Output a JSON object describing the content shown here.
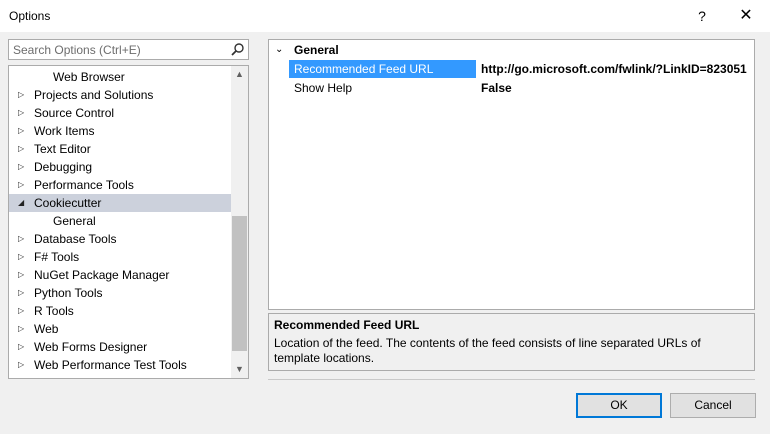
{
  "window": {
    "title": "Options",
    "help_label": "?",
    "close_label": "✕"
  },
  "search": {
    "placeholder": "Search Options (Ctrl+E)",
    "icon": "search-icon"
  },
  "tree": {
    "items": [
      {
        "label": "Web Browser",
        "arrow": "",
        "child": true,
        "selected": false
      },
      {
        "label": "Projects and Solutions",
        "arrow": "▷",
        "child": false,
        "selected": false
      },
      {
        "label": "Source Control",
        "arrow": "▷",
        "child": false,
        "selected": false
      },
      {
        "label": "Work Items",
        "arrow": "▷",
        "child": false,
        "selected": false
      },
      {
        "label": "Text Editor",
        "arrow": "▷",
        "child": false,
        "selected": false
      },
      {
        "label": "Debugging",
        "arrow": "▷",
        "child": false,
        "selected": false
      },
      {
        "label": "Performance Tools",
        "arrow": "▷",
        "child": false,
        "selected": false
      },
      {
        "label": "Cookiecutter",
        "arrow": "◢",
        "child": false,
        "selected": true
      },
      {
        "label": "General",
        "arrow": "",
        "child": true,
        "selected": false
      },
      {
        "label": "Database Tools",
        "arrow": "▷",
        "child": false,
        "selected": false
      },
      {
        "label": "F# Tools",
        "arrow": "▷",
        "child": false,
        "selected": false
      },
      {
        "label": "NuGet Package Manager",
        "arrow": "▷",
        "child": false,
        "selected": false
      },
      {
        "label": "Python Tools",
        "arrow": "▷",
        "child": false,
        "selected": false
      },
      {
        "label": "R Tools",
        "arrow": "▷",
        "child": false,
        "selected": false
      },
      {
        "label": "Web",
        "arrow": "▷",
        "child": false,
        "selected": false
      },
      {
        "label": "Web Forms Designer",
        "arrow": "▷",
        "child": false,
        "selected": false
      },
      {
        "label": "Web Performance Test Tools",
        "arrow": "▷",
        "child": false,
        "selected": false
      }
    ],
    "scroll_up": "▲",
    "scroll_down": "▼"
  },
  "grid": {
    "category": {
      "chevron": "⌄",
      "name": "General"
    },
    "properties": [
      {
        "name": "Recommended Feed URL",
        "value": "http://go.microsoft.com/fwlink/?LinkID=823051",
        "selected": true
      },
      {
        "name": "Show Help",
        "value": "False",
        "selected": false
      }
    ]
  },
  "description": {
    "title": "Recommended Feed URL",
    "text": "Location of the feed. The contents of the feed consists of line separated URLs of template locations."
  },
  "buttons": {
    "ok": "OK",
    "cancel": "Cancel"
  },
  "colors": {
    "accent": "#0078d7",
    "selection": "#3399ff",
    "tree_selection": "#ccd1dc"
  }
}
